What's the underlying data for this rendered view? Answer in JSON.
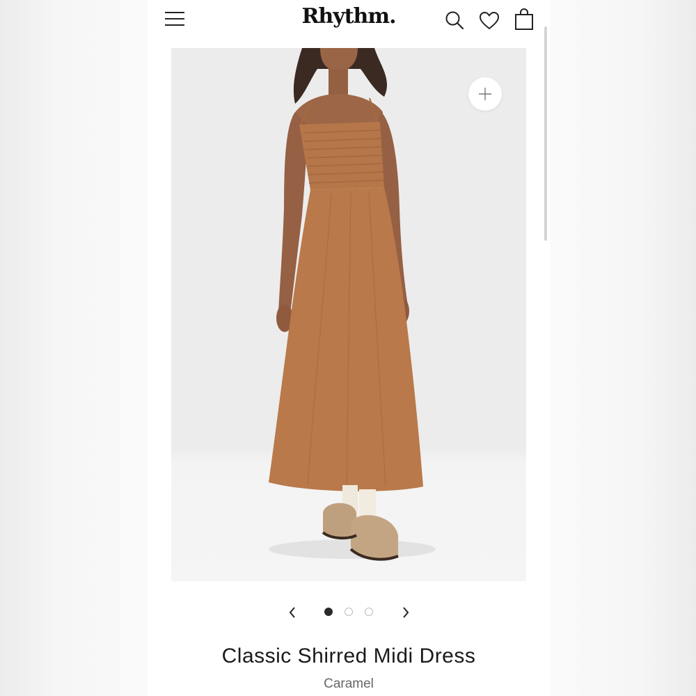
{
  "header": {
    "logo_text": "Rhythm.",
    "icons": [
      "menu-icon",
      "search-icon",
      "heart-icon",
      "shopping-bag-icon"
    ]
  },
  "gallery": {
    "zoom_icon": "plus-icon",
    "slide_count": 3,
    "active_slide": 1,
    "dress_color": "#b9794a",
    "background_color": "#ececec"
  },
  "product": {
    "name": "Classic Shirred Midi Dress",
    "color_name": "Caramel"
  }
}
